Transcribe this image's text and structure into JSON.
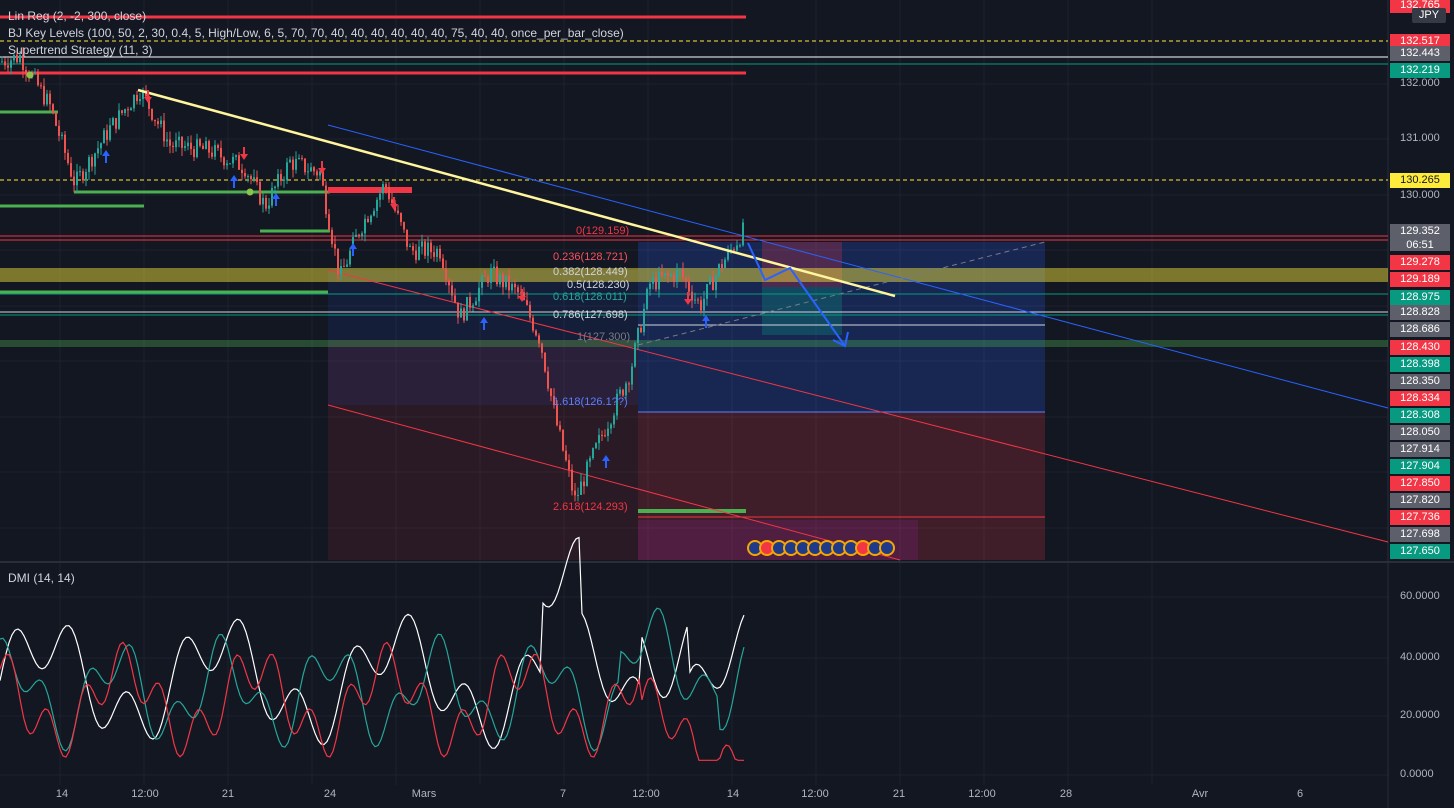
{
  "legends": {
    "linreg": "Lin Reg (2, -2, 300, close)",
    "keylevels": "BJ Key Levels (100, 50, 2, 30, 0.4, 5, High/Low, 6, 5, 70, 70, 40, 40, 40, 40, 40, 40, 75, 40, 40, once_per_bar_close)",
    "supertrend": "Supertrend Strategy (11, 3)",
    "dmi": "DMI (14, 14)"
  },
  "currency_badge": "JPY",
  "countdown": "06:51",
  "colors": {
    "background": "#131722",
    "red_label": "#f23645",
    "green_label": "#089981",
    "gray_label": "#5d606b",
    "yellow_label": "#ffeb3b",
    "blue_channel": "#2962ff",
    "trendline": "#fff59d"
  },
  "chart_data": [
    {
      "type": "line",
      "subtype": "candlestick price chart",
      "y_range": [
        124.0,
        132.8
      ],
      "y_ticks": [
        "132.000",
        "131.000",
        "130.000"
      ],
      "x_ticks": [
        "14",
        "12:00",
        "21",
        "24",
        "Mars",
        "7",
        "12:00",
        "14",
        "12:00",
        "21",
        "12:00",
        "28",
        "Avr",
        "6"
      ],
      "price_labels": [
        {
          "value": "132.765",
          "kind": "red"
        },
        {
          "value": "132.517",
          "kind": "red"
        },
        {
          "value": "132.443",
          "kind": "gray"
        },
        {
          "value": "132.219",
          "kind": "green"
        },
        {
          "value": "130.265",
          "kind": "yellow"
        },
        {
          "value": "129.352",
          "kind": "gray"
        },
        {
          "value": "129.278",
          "kind": "red"
        },
        {
          "value": "129.189",
          "kind": "red"
        },
        {
          "value": "128.975",
          "kind": "green"
        },
        {
          "value": "128.828",
          "kind": "gray"
        },
        {
          "value": "128.686",
          "kind": "gray"
        },
        {
          "value": "128.430",
          "kind": "red"
        },
        {
          "value": "128.398",
          "kind": "green"
        },
        {
          "value": "128.350",
          "kind": "gray"
        },
        {
          "value": "128.334",
          "kind": "red"
        },
        {
          "value": "128.308",
          "kind": "green"
        },
        {
          "value": "128.050",
          "kind": "gray"
        },
        {
          "value": "127.914",
          "kind": "gray"
        },
        {
          "value": "127.904",
          "kind": "green"
        },
        {
          "value": "127.850",
          "kind": "red"
        },
        {
          "value": "127.820",
          "kind": "gray"
        },
        {
          "value": "127.736",
          "kind": "red"
        },
        {
          "value": "127.698",
          "kind": "gray"
        },
        {
          "value": "127.650",
          "kind": "green"
        }
      ],
      "fibonacci": [
        {
          "label": "0(129.159)",
          "color": "#f23645"
        },
        {
          "label": "0.236(128.721)",
          "color": "#f7525f"
        },
        {
          "label": "0.382(128.449)",
          "color": "#d1d4dc"
        },
        {
          "label": "0.5(128.230)",
          "color": "#d1d4dc"
        },
        {
          "label": "0.618(128.011)",
          "color": "#26a69a"
        },
        {
          "label": "0.786(127.698)",
          "color": "#d1d4dc"
        },
        {
          "label": "1(127.300)",
          "color": "#787b86"
        },
        {
          "label": "1.618(126.1??)",
          "color": "#5b7fff"
        },
        {
          "label": "2.618(124.293)",
          "color": "#f23645"
        }
      ]
    },
    {
      "type": "line",
      "subtype": "DMI oscillator",
      "y_range": [
        0,
        70
      ],
      "y_ticks": [
        "60.0000",
        "40.0000",
        "20.0000",
        "0.0000"
      ],
      "series_colors": [
        "#ffffff",
        "#26a69a",
        "#f23645"
      ]
    }
  ]
}
